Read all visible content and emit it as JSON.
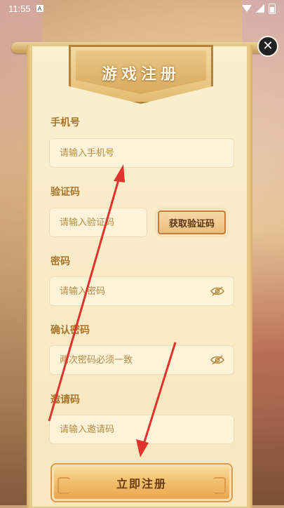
{
  "status_bar": {
    "time": "11:55",
    "app_badge": "A"
  },
  "dialog": {
    "title": "游戏注册",
    "close_symbol": "✕",
    "fields": {
      "phone": {
        "label": "手机号",
        "placeholder": "请输入手机号"
      },
      "code": {
        "label": "验证码",
        "placeholder": "请输入验证码",
        "button": "获取验证码"
      },
      "password": {
        "label": "密码",
        "placeholder": "请输入密码"
      },
      "confirm": {
        "label": "确认密码",
        "placeholder": "两次密码必须一致"
      },
      "invite": {
        "label": "邀请码",
        "placeholder": "请输入邀请码"
      }
    },
    "submit": "立即注册"
  },
  "colors": {
    "label": "#a8742b",
    "arrow": "#e0332d",
    "panel": "#fbefcf"
  },
  "icons": [
    "wifi-icon",
    "signal-icon",
    "battery-icon",
    "close-icon",
    "eye-off-icon"
  ]
}
